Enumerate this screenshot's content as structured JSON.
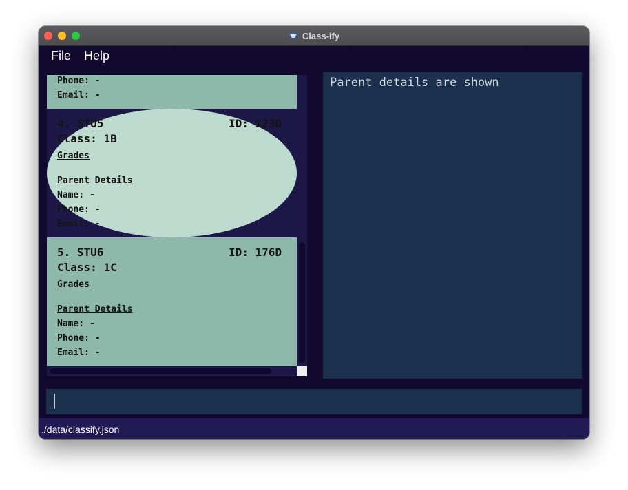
{
  "window": {
    "title": "Class-ify"
  },
  "menu": {
    "file": "File",
    "help": "Help"
  },
  "students": [
    {
      "phone_label": "Phone:",
      "phone": "-",
      "email_label": "Email:",
      "email": "-"
    },
    {
      "index": "4.",
      "name": "STU5",
      "id_label": "ID:",
      "id": "123D",
      "class_label": "Class:",
      "class": "1B",
      "grades_label": "Grades",
      "parent_label": "Parent Details",
      "pname_label": "Name:",
      "pname": "-",
      "phone_label": "Phone:",
      "phone": "-",
      "email_label": "Email:",
      "email": "-"
    },
    {
      "index": "5.",
      "name": "STU6",
      "id_label": "ID:",
      "id": "176D",
      "class_label": "Class:",
      "class": "1C",
      "grades_label": "Grades",
      "parent_label": "Parent Details",
      "pname_label": "Name:",
      "pname": "-",
      "phone_label": "Phone:",
      "phone": "-",
      "email_label": "Email:",
      "email": "-"
    }
  ],
  "detail": {
    "text": "Parent details are shown"
  },
  "command": {
    "value": ""
  },
  "status": {
    "path": "./data/classify.json"
  },
  "colors": {
    "card_dark": "#8db8aa",
    "card_light": "#bddbcf",
    "panel": "#1a304d",
    "background": "#120a2e"
  }
}
